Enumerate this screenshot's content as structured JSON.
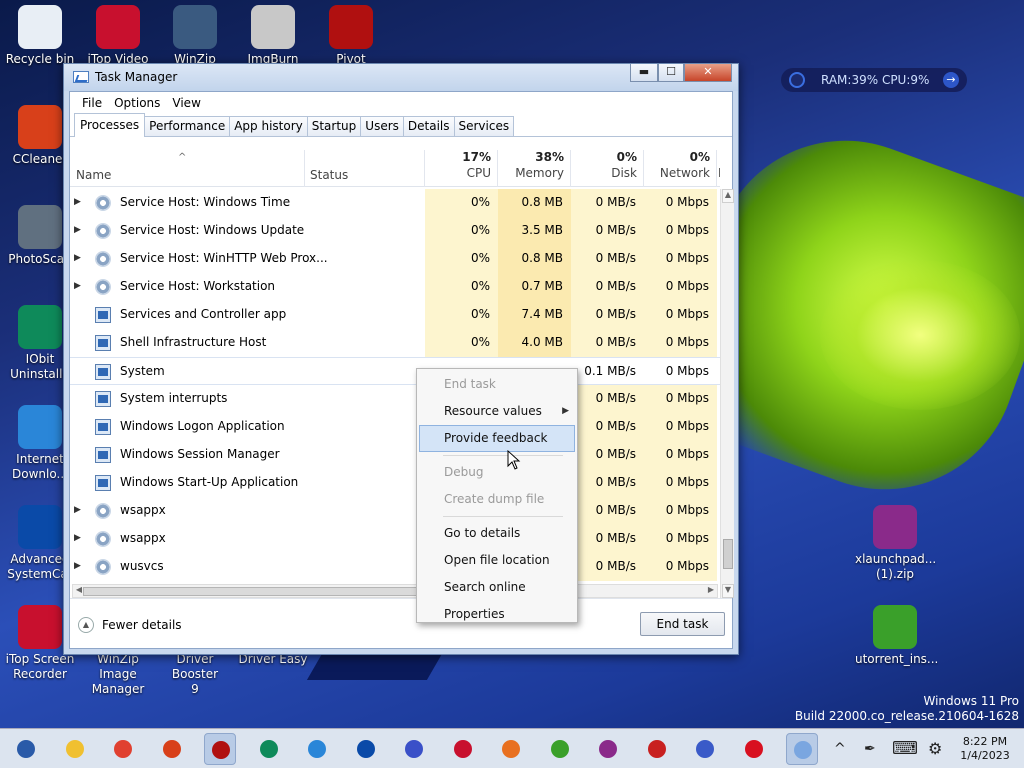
{
  "desktop": {
    "icons": [
      {
        "name": "recycle-bin",
        "label": "Recycle bin",
        "label2": "",
        "color": "#e8eef5"
      },
      {
        "name": "itop-video",
        "label": "iTop Video",
        "label2": "",
        "color": "#c8102e"
      },
      {
        "name": "winzip",
        "label": "WinZip",
        "label2": "",
        "color": "#3a5a80"
      },
      {
        "name": "imgburn",
        "label": "ImgBurn",
        "label2": "",
        "color": "#c8c8c8"
      },
      {
        "name": "pivot",
        "label": "Pivot",
        "label2": "",
        "color": "#b01010"
      },
      {
        "name": "ccleaner",
        "label": "CCleaner",
        "label2": "",
        "color": "#d8401a"
      },
      {
        "name": "photoscape",
        "label": "PhotoScap",
        "label2": "",
        "color": "#607080"
      },
      {
        "name": "iobit-uninstaller",
        "label": "IObit",
        "label2": "Uninstalle",
        "color": "#0e8a5a"
      },
      {
        "name": "internet-download-manager",
        "label": "Internet",
        "label2": "Downlo...",
        "color": "#2a86d8"
      },
      {
        "name": "advanced-systemcare",
        "label": "Advanced",
        "label2": "SystemCar",
        "color": "#0a4aa8"
      },
      {
        "name": "itop-screen-recorder",
        "label": "iTop Screen",
        "label2": "Recorder",
        "color": "#c8102e"
      },
      {
        "name": "winzip-image-manager",
        "label": "WinZip Image",
        "label2": "Manager",
        "color": "#2a6ab8"
      },
      {
        "name": "driver-booster",
        "label": "Driver Booster",
        "label2": "9",
        "color": "#c82020"
      },
      {
        "name": "driver-easy",
        "label": "Driver Easy",
        "label2": "",
        "color": "#1a7ac8"
      },
      {
        "name": "xlaunchpad-zip",
        "label": "xlaunchpad...",
        "label2": "(1).zip",
        "color": "#8a2a8a"
      },
      {
        "name": "utorrent-installer",
        "label": "utorrent_ins...",
        "label2": "",
        "color": "#3aa02a"
      }
    ]
  },
  "sysmon": {
    "text": "RAM:39% CPU:9%",
    "arrow": "→"
  },
  "window": {
    "title": "Task Manager",
    "controls": {
      "minimize": "▬",
      "maximize": "☐",
      "close": "✕"
    },
    "menu": [
      "File",
      "Options",
      "View"
    ],
    "tabs": [
      "Processes",
      "Performance",
      "App history",
      "Startup",
      "Users",
      "Details",
      "Services"
    ],
    "active_tab": "Processes",
    "columns": {
      "name": "Name",
      "status": "Status",
      "cpu": {
        "pct": "17%",
        "label": "CPU"
      },
      "memory": {
        "pct": "38%",
        "label": "Memory"
      },
      "disk": {
        "pct": "0%",
        "label": "Disk"
      },
      "network": {
        "pct": "0%",
        "label": "Network"
      },
      "power": "Po"
    },
    "rows": [
      {
        "name": "Service Host: Windows Time",
        "expand": true,
        "icon": "gear",
        "cpu": "0%",
        "mem": "0.8 MB",
        "disk": "0 MB/s",
        "net": "0 Mbps"
      },
      {
        "name": "Service Host: Windows Update",
        "expand": true,
        "icon": "gear",
        "cpu": "0%",
        "mem": "3.5 MB",
        "disk": "0 MB/s",
        "net": "0 Mbps"
      },
      {
        "name": "Service Host: WinHTTP Web Prox...",
        "expand": true,
        "icon": "gear",
        "cpu": "0%",
        "mem": "0.8 MB",
        "disk": "0 MB/s",
        "net": "0 Mbps"
      },
      {
        "name": "Service Host: Workstation",
        "expand": true,
        "icon": "gear",
        "cpu": "0%",
        "mem": "0.7 MB",
        "disk": "0 MB/s",
        "net": "0 Mbps"
      },
      {
        "name": "Services and Controller app",
        "expand": false,
        "icon": "win",
        "cpu": "0%",
        "mem": "7.4 MB",
        "disk": "0 MB/s",
        "net": "0 Mbps"
      },
      {
        "name": "Shell Infrastructure Host",
        "expand": false,
        "icon": "win",
        "cpu": "0%",
        "mem": "4.0 MB",
        "disk": "0 MB/s",
        "net": "0 Mbps"
      },
      {
        "name": "System",
        "expand": false,
        "icon": "win",
        "cpu": "",
        "mem": "",
        "disk": "0.1 MB/s",
        "net": "0 Mbps",
        "selected": true
      },
      {
        "name": "System interrupts",
        "expand": false,
        "icon": "win",
        "cpu": "",
        "mem": "",
        "disk": "0 MB/s",
        "net": "0 Mbps"
      },
      {
        "name": "Windows Logon Application",
        "expand": false,
        "icon": "win",
        "cpu": "",
        "mem": "",
        "disk": "0 MB/s",
        "net": "0 Mbps"
      },
      {
        "name": "Windows Session Manager",
        "expand": false,
        "icon": "win",
        "cpu": "",
        "mem": "",
        "disk": "0 MB/s",
        "net": "0 Mbps"
      },
      {
        "name": "Windows Start-Up Application",
        "expand": false,
        "icon": "win",
        "cpu": "",
        "mem": "",
        "disk": "0 MB/s",
        "net": "0 Mbps"
      },
      {
        "name": "wsappx",
        "expand": true,
        "icon": "gear",
        "cpu": "",
        "mem": "",
        "disk": "0 MB/s",
        "net": "0 Mbps"
      },
      {
        "name": "wsappx",
        "expand": true,
        "icon": "gear",
        "cpu": "",
        "mem": "",
        "disk": "0 MB/s",
        "net": "0 Mbps"
      },
      {
        "name": "wusvcs",
        "expand": true,
        "icon": "gear",
        "cpu": "",
        "mem": "",
        "disk": "0 MB/s",
        "net": "0 Mbps"
      }
    ],
    "footer": {
      "fewer_details": "Fewer details",
      "end_task": "End task"
    }
  },
  "context_menu": {
    "items": [
      {
        "label": "End task",
        "disabled": true
      },
      {
        "label": "Resource values",
        "submenu": true
      },
      {
        "label": "Provide feedback",
        "highlighted": true
      },
      {
        "sep": true
      },
      {
        "label": "Debug",
        "disabled": true
      },
      {
        "label": "Create dump file",
        "disabled": true
      },
      {
        "sep": true
      },
      {
        "label": "Go to details"
      },
      {
        "label": "Open file location"
      },
      {
        "label": "Search online"
      },
      {
        "label": "Properties"
      }
    ]
  },
  "build": {
    "line1": "Windows 11 Pro",
    "line2": "Build 22000.co_release.210604-1628"
  },
  "taskbar": {
    "apps": [
      {
        "name": "start-button",
        "color": "#2a5aa8",
        "active": false
      },
      {
        "name": "file-explorer",
        "color": "#f0c030",
        "active": false
      },
      {
        "name": "chrome",
        "color": "#e04030",
        "active": false
      },
      {
        "name": "ccleaner",
        "color": "#d8401a",
        "active": false
      },
      {
        "name": "pivot",
        "color": "#b01010",
        "active": true
      },
      {
        "name": "iobit-uninstaller",
        "color": "#0e8a5a",
        "active": false
      },
      {
        "name": "internet-download-manager",
        "color": "#2a86d8",
        "active": false
      },
      {
        "name": "advanced-systemcare",
        "color": "#0a4aa8",
        "active": false
      },
      {
        "name": "photoscape-p",
        "color": "#3a50c8",
        "active": false
      },
      {
        "name": "itop-screen-recorder",
        "color": "#c8102e",
        "active": false
      },
      {
        "name": "chromium-browser",
        "color": "#e87020",
        "active": false
      },
      {
        "name": "utorrent",
        "color": "#3aa02a",
        "active": false
      },
      {
        "name": "winrar",
        "color": "#8a2a8a",
        "active": false
      },
      {
        "name": "driver-booster",
        "color": "#c82020",
        "active": false
      },
      {
        "name": "registry-tool",
        "color": "#3a5ac8",
        "active": false
      },
      {
        "name": "opera",
        "color": "#d81020",
        "active": false
      },
      {
        "name": "task-manager",
        "color": "#7aa6e0",
        "active": true
      }
    ],
    "tray": {
      "chevron": "^",
      "pen": "✒",
      "keyboard": "⌨",
      "gear": "⚙"
    },
    "time": "8:22 PM",
    "date": "1/4/2023"
  }
}
